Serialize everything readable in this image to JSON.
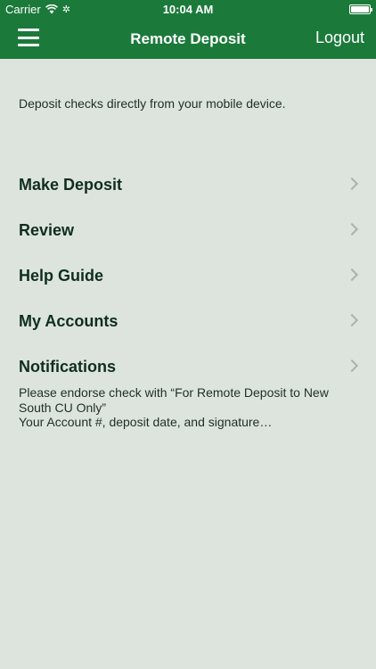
{
  "status_bar": {
    "carrier": "Carrier",
    "time": "10:04 AM"
  },
  "nav": {
    "title": "Remote Deposit",
    "logout_label": "Logout"
  },
  "intro_text": "Deposit checks directly from your mobile device.",
  "menu": {
    "items": [
      {
        "label": "Make Deposit"
      },
      {
        "label": "Review"
      },
      {
        "label": "Help Guide"
      },
      {
        "label": "My Accounts"
      },
      {
        "label": "Notifications"
      }
    ]
  },
  "notice": {
    "line1": "Please endorse check with “For Remote Deposit to New South CU Only”",
    "line2": "Your Account #, deposit date, and signature…"
  },
  "colors": {
    "header_green": "#1b7a3a",
    "background": "#dde4de"
  }
}
